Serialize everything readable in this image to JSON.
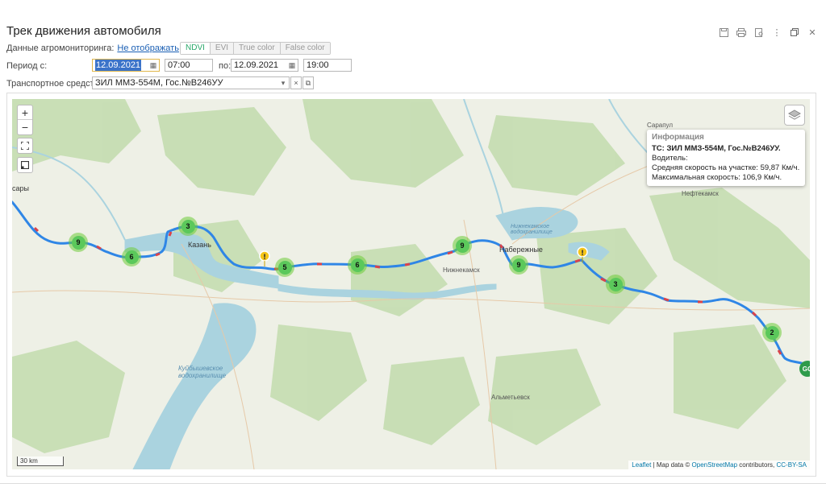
{
  "window": {
    "title": "Трек движения автомобиля",
    "icons": [
      "save-icon",
      "print-icon",
      "preview-icon",
      "more-icon",
      "restore-icon",
      "close-icon"
    ]
  },
  "agro": {
    "label": "Данные агромониторинга:",
    "link": "Не отображать",
    "modes": [
      "NDVI",
      "EVI",
      "True color",
      "False color"
    ]
  },
  "period": {
    "label": "Период с:",
    "date_from": "12.09.2021",
    "time_from": "07:00",
    "to_label": "по:",
    "date_to": "12.09.2021",
    "time_to": "19:00"
  },
  "vehicle": {
    "label": "Транспортное средство:",
    "value": "ЗИЛ ММЗ-554М, Гос.№В246УУ"
  },
  "map": {
    "info": {
      "header": "Информация",
      "vehicle": "ТС: ЗИЛ ММЗ-554М, Гос.№В246УУ.",
      "driver": "Водитель:",
      "avg_speed": "Средняя скорость на участке: 59,87 Км/ч.",
      "max_speed": "Максимальная скорость: 106,9 Км/ч."
    },
    "scale": "30 km",
    "attribution": {
      "leaflet": "Leaflet",
      "sep": " | Map data © ",
      "osm": "OpenStreetMap",
      "mid": " contributors, ",
      "license": "CC-BY-SA"
    },
    "place_labels": {
      "kazan": "Казань",
      "naberezhnye": "Набережные",
      "nizhnekamsk": "Нижнекамск",
      "almetyevsk": "Альметьевск",
      "sarapul": "Сарапул",
      "neftekamsk": "Нефтекамск",
      "kuybyshev": "Куйбышевское водохранилище",
      "sary": "сары",
      "nizhnekamskoe_res": "Нижнекамское водохранилище"
    },
    "clusters": [
      "9",
      "6",
      "3",
      "5",
      "6",
      "9",
      "9",
      "3",
      "2"
    ],
    "end_marker": "GO",
    "route_color": "#2f86e6",
    "cluster_color": "#5bc85b"
  }
}
